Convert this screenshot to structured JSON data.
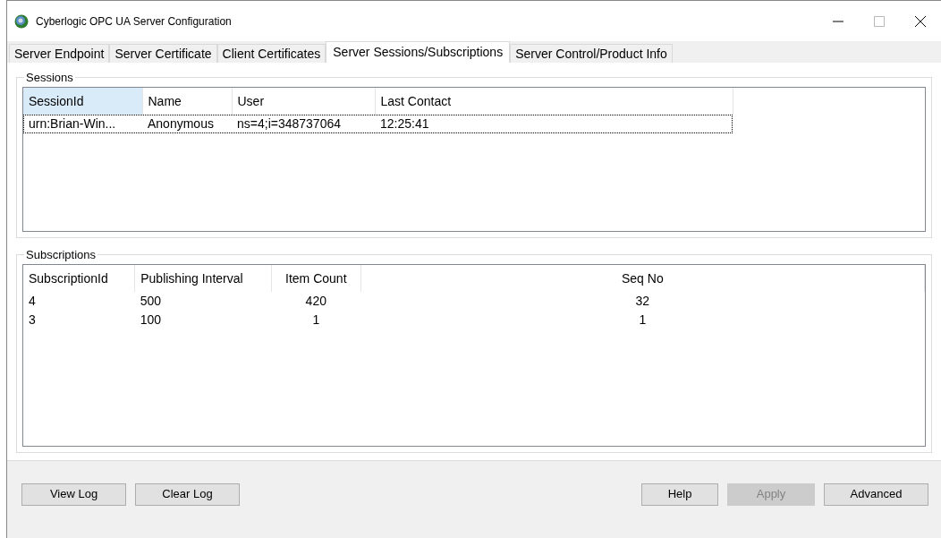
{
  "window": {
    "title": "Cyberlogic OPC UA Server Configuration"
  },
  "tabs": [
    {
      "label": "Server Endpoint",
      "selected": false
    },
    {
      "label": "Server Certificate",
      "selected": false
    },
    {
      "label": "Client Certificates",
      "selected": false
    },
    {
      "label": "Server Sessions/Subscriptions",
      "selected": true
    },
    {
      "label": "Server Control/Product Info",
      "selected": false
    }
  ],
  "sessions": {
    "title": "Sessions",
    "columns": [
      {
        "label": "SessionId",
        "highlighted": true
      },
      {
        "label": "Name",
        "highlighted": false
      },
      {
        "label": "User",
        "highlighted": false
      },
      {
        "label": "Last Contact",
        "highlighted": false
      }
    ],
    "rows": [
      {
        "cells": [
          "urn:Brian-Win...",
          "Anonymous",
          "ns=4;i=348737064",
          "12:25:41"
        ],
        "focused": true
      }
    ]
  },
  "subscriptions": {
    "title": "Subscriptions",
    "columns": [
      {
        "label": "SubscriptionId",
        "kind": "text"
      },
      {
        "label": "Publishing Interval",
        "kind": "text"
      },
      {
        "label": "Item Count",
        "kind": "count"
      },
      {
        "label": "Seq No",
        "kind": "count"
      }
    ],
    "rows": [
      {
        "cells": [
          "4",
          "500",
          "420",
          "32"
        ]
      },
      {
        "cells": [
          "3",
          "100",
          "1",
          "1"
        ]
      }
    ]
  },
  "buttons_left": [
    {
      "label": "View Log",
      "disabled": false
    },
    {
      "label": "Clear Log",
      "disabled": false
    }
  ],
  "buttons_right": [
    {
      "label": "Help",
      "disabled": false
    },
    {
      "label": "Apply",
      "disabled": true
    },
    {
      "label": "Advanced",
      "disabled": false
    }
  ]
}
